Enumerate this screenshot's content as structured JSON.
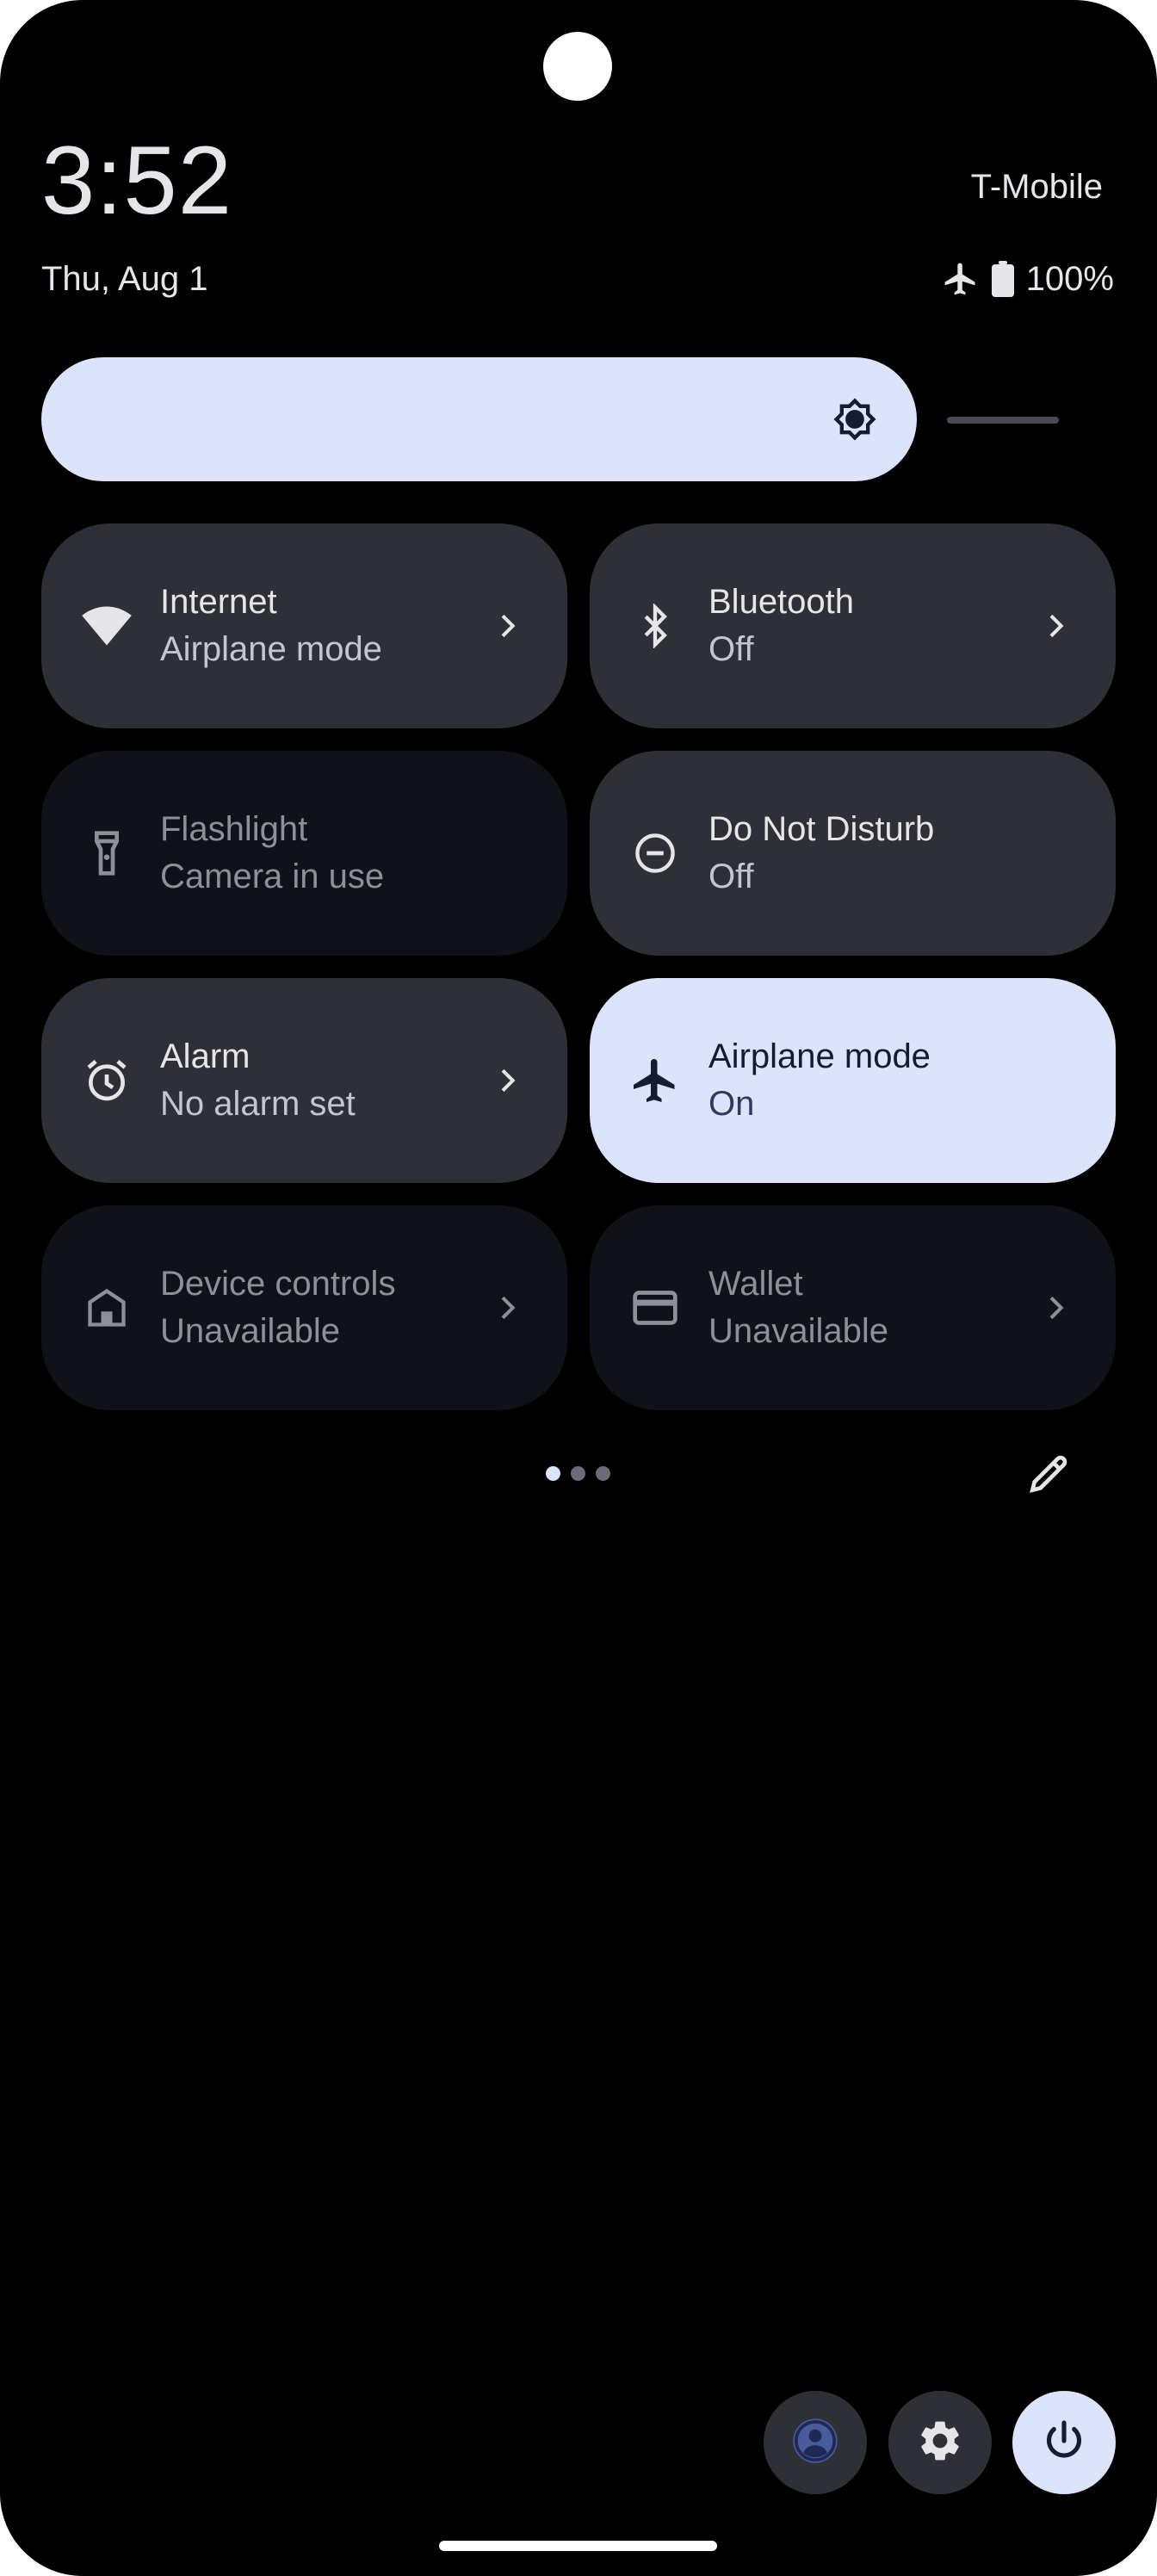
{
  "status_bar": {
    "time": "3:52",
    "date": "Thu, Aug 1",
    "carrier": "T-Mobile",
    "battery": "100%",
    "airplane_icon": "airplane-icon",
    "battery_icon": "battery-full-icon"
  },
  "brightness": {
    "level": 0.86,
    "icon": "brightness-icon"
  },
  "tiles": [
    {
      "title": "Internet",
      "subtitle": "Airplane mode",
      "icon": "wifi-icon",
      "state": "on",
      "chevron": true
    },
    {
      "title": "Bluetooth",
      "subtitle": "Off",
      "icon": "bluetooth-icon",
      "state": "on",
      "chevron": true
    },
    {
      "title": "Flashlight",
      "subtitle": "Camera in use",
      "icon": "flashlight-icon",
      "state": "unavailable",
      "chevron": false
    },
    {
      "title": "Do Not Disturb",
      "subtitle": "Off",
      "icon": "do-not-disturb-icon",
      "state": "off",
      "chevron": false
    },
    {
      "title": "Alarm",
      "subtitle": "No alarm set",
      "icon": "alarm-icon",
      "state": "off",
      "chevron": true
    },
    {
      "title": "Airplane mode",
      "subtitle": "On",
      "icon": "airplane-icon",
      "state": "active",
      "chevron": false
    },
    {
      "title": "Device controls",
      "subtitle": "Unavailable",
      "icon": "home-icon",
      "state": "unavailable",
      "chevron": true
    },
    {
      "title": "Wallet",
      "subtitle": "Unavailable",
      "icon": "wallet-card-icon",
      "state": "unavailable",
      "chevron": true
    }
  ],
  "pager": {
    "pages": 3,
    "current": 1
  },
  "actions": {
    "edit_icon": "pencil-icon",
    "user_icon": "user-icon",
    "settings_icon": "gear-icon",
    "power_icon": "power-icon"
  },
  "colors": {
    "background": "#000000",
    "tile": "#2f3036",
    "tile_unavailable": "#111217",
    "accent": "#dce3fb",
    "accent_text": "#141b34"
  }
}
